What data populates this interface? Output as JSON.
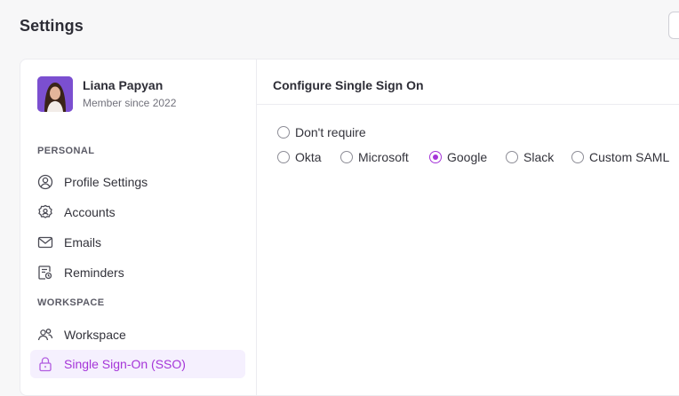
{
  "page": {
    "title": "Settings"
  },
  "profile": {
    "name": "Liana Papyan",
    "subtitle": "Member since 2022"
  },
  "sidebar": {
    "personal_label": "PERSONAL",
    "workspace_label": "WORKSPACE",
    "personal_items": [
      {
        "label": "Profile Settings",
        "icon": "user-circle-icon"
      },
      {
        "label": "Accounts",
        "icon": "user-gear-icon"
      },
      {
        "label": "Emails",
        "icon": "envelope-icon"
      },
      {
        "label": "Reminders",
        "icon": "reminder-icon"
      }
    ],
    "workspace_items": [
      {
        "label": "Workspace",
        "icon": "users-icon"
      },
      {
        "label": "Single Sign-On (SSO)",
        "icon": "lock-icon",
        "active": true
      }
    ]
  },
  "content": {
    "title": "Configure Single Sign On",
    "options": [
      {
        "label": "Don't require",
        "checked": false
      },
      {
        "label": "Okta",
        "checked": false
      },
      {
        "label": "Microsoft",
        "checked": false
      },
      {
        "label": "Google",
        "checked": true
      },
      {
        "label": "Slack",
        "checked": false
      },
      {
        "label": "Custom SAML",
        "checked": false
      }
    ]
  },
  "colors": {
    "accent": "#a535d8",
    "active_bg": "#f5f0fe",
    "background": "#f7f7f8",
    "border": "#ececf0"
  }
}
